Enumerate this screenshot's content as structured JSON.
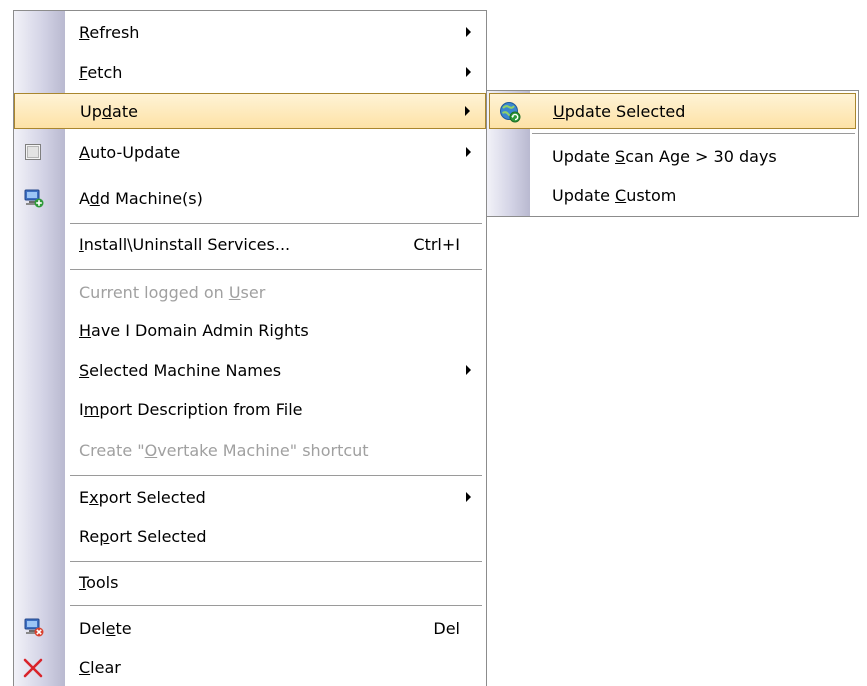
{
  "main_menu": {
    "items": [
      {
        "pre": "",
        "key": "R",
        "post": "efresh",
        "shortcut": ""
      },
      {
        "pre": "",
        "key": "F",
        "post": "etch",
        "shortcut": ""
      },
      {
        "pre": "Up",
        "key": "d",
        "post": "ate",
        "shortcut": ""
      },
      {
        "pre": "",
        "key": "A",
        "post": "uto-Update",
        "shortcut": ""
      },
      {
        "pre": "A",
        "key": "d",
        "post": "d Machine(s)",
        "shortcut": ""
      },
      {
        "pre": "",
        "key": "I",
        "post": "nstall\\Uninstall Services...",
        "shortcut": "Ctrl+I"
      },
      {
        "pre": "Current logged on ",
        "key": "U",
        "post": "ser",
        "shortcut": ""
      },
      {
        "pre": "",
        "key": "H",
        "post": "ave I Domain Admin Rights",
        "shortcut": ""
      },
      {
        "pre": "",
        "key": "S",
        "post": "elected Machine Names",
        "shortcut": ""
      },
      {
        "pre": "I",
        "key": "m",
        "post": "port Description from File",
        "shortcut": ""
      },
      {
        "pre": "Create \"",
        "key": "O",
        "post": "vertake Machine\" shortcut",
        "shortcut": ""
      },
      {
        "pre": "E",
        "key": "x",
        "post": "port Selected",
        "shortcut": ""
      },
      {
        "pre": "Re",
        "key": "p",
        "post": "ort Selected",
        "shortcut": ""
      },
      {
        "pre": "",
        "key": "T",
        "post": "ools",
        "shortcut": ""
      },
      {
        "pre": "Del",
        "key": "e",
        "post": "te",
        "shortcut": "Del"
      },
      {
        "pre": "",
        "key": "C",
        "post": "lear",
        "shortcut": ""
      }
    ]
  },
  "sub_menu": {
    "items": [
      {
        "pre": "",
        "key": "U",
        "post": "pdate Selected"
      },
      {
        "pre": "Update ",
        "key": "S",
        "post": "can Age > 30 days"
      },
      {
        "pre": "Update ",
        "key": "C",
        "post": "ustom"
      }
    ]
  },
  "icons": {
    "checkbox": "checkbox-icon",
    "add_machine": "add-machine-icon",
    "delete_machine": "delete-machine-icon",
    "clear": "clear-x-icon",
    "update_selected": "globe-update-icon"
  },
  "colors": {
    "highlight_top": "#fff3d6",
    "highlight_bottom": "#fde2a6",
    "highlight_border": "#a9862e",
    "disabled_text": "#a0a0a0",
    "clear_icon": "#d9232a"
  }
}
